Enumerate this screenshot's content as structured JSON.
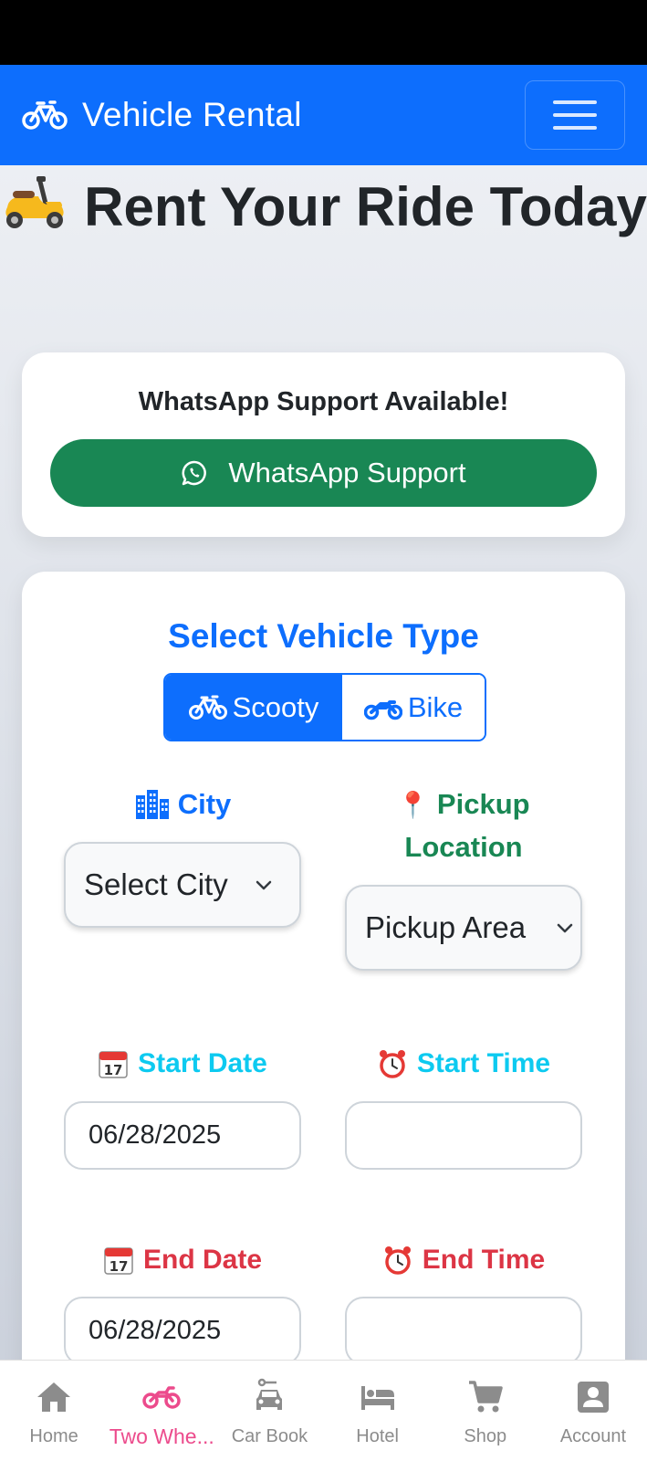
{
  "navbar": {
    "brand": "Vehicle Rental",
    "menu_icon": "hamburger-menu-icon"
  },
  "hero": {
    "emoji_icon": "scooter-emoji-icon",
    "title": "Rent Your Ride Today"
  },
  "whatsapp": {
    "heading": "WhatsApp Support Available!",
    "button_label": "WhatsApp Support",
    "button_color": "#198754"
  },
  "form": {
    "section_title": "Select Vehicle Type",
    "vehicle_types": [
      {
        "label": "Scooty",
        "icon": "bicycle-icon",
        "selected": true
      },
      {
        "label": "Bike",
        "icon": "motorcycle-icon",
        "selected": false
      }
    ],
    "city": {
      "label": "City",
      "icon": "city-icon",
      "value": "Select City"
    },
    "pickup": {
      "label": "Pickup Location",
      "icon": "pin-emoji",
      "value": "Pickup Area"
    },
    "start_date": {
      "label": "Start Date",
      "icon": "calendar-emoji",
      "value": "06/28/2025"
    },
    "start_time": {
      "label": "Start Time",
      "icon": "alarm-clock-emoji",
      "value": ""
    },
    "end_date": {
      "label": "End Date",
      "icon": "calendar-emoji",
      "value": "06/28/2025"
    },
    "end_time": {
      "label": "End Time",
      "icon": "alarm-clock-emoji",
      "value": ""
    }
  },
  "bottom_nav": {
    "items": [
      {
        "label": "Home",
        "icon": "home-icon",
        "active": false
      },
      {
        "label": "Two Whe...",
        "icon": "motorcycle-icon",
        "active": true
      },
      {
        "label": "Car Book",
        "icon": "car-icon",
        "active": false
      },
      {
        "label": "Hotel",
        "icon": "bed-icon",
        "active": false
      },
      {
        "label": "Shop",
        "icon": "cart-icon",
        "active": false
      },
      {
        "label": "Account",
        "icon": "account-icon",
        "active": false
      }
    ],
    "active_color": "#ec4b8c"
  },
  "colors": {
    "primary": "#0d6efd",
    "success": "#198754",
    "info": "#0dcaf0",
    "danger": "#dc3545"
  }
}
